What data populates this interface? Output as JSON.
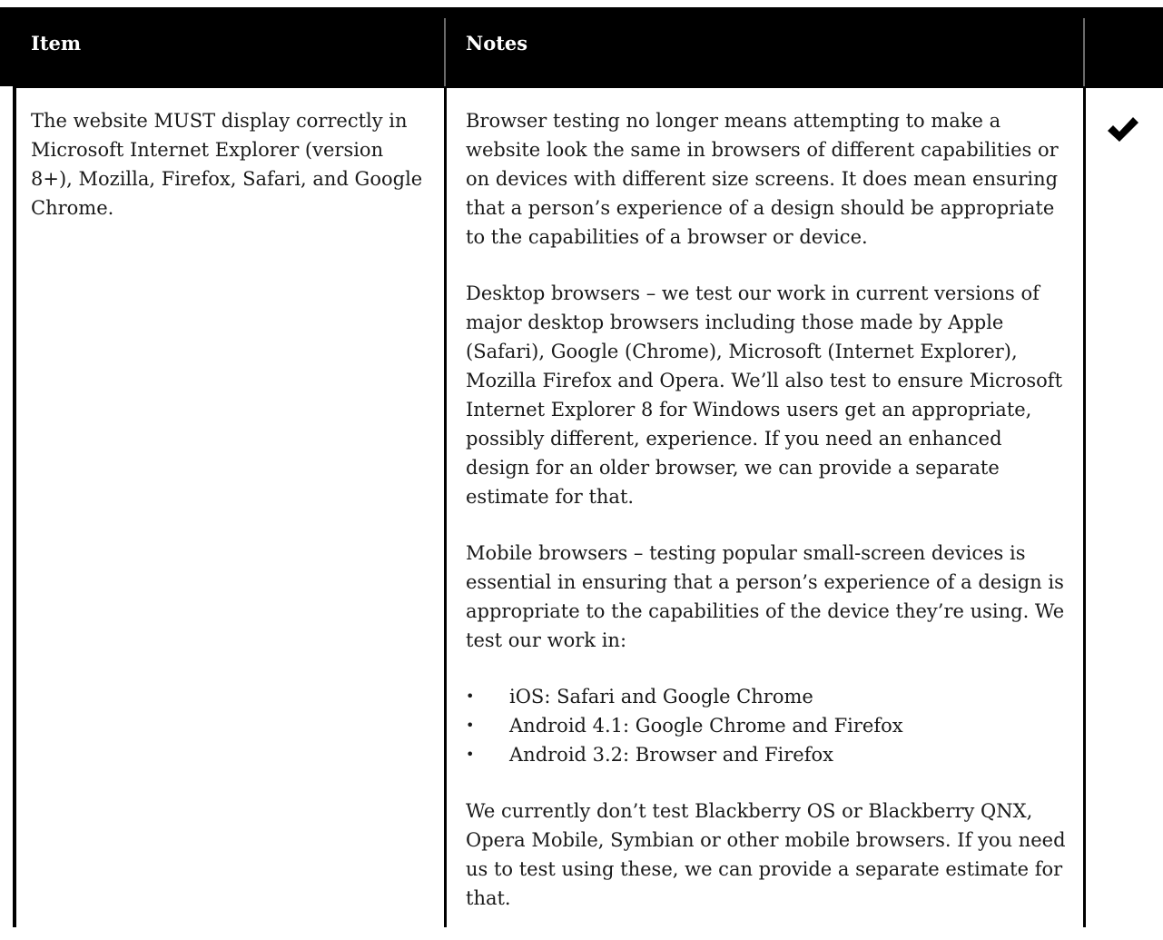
{
  "table": {
    "headers": {
      "item": "Item",
      "notes": "Notes"
    },
    "row": {
      "item": "The website MUST display correctly in Microsoft Internet Explorer (version 8+), Mozilla, Firefox, Safari, and Google Chrome.",
      "notes": {
        "p1": "Browser testing no longer means attempting to make a website look the same in browsers of different capabilities or on devices with different size screens. It does mean ensuring that a person’s experience of a design should be appropriate to the capabilities of a browser or device.",
        "p2": "Desktop browsers – we test our work in current versions of major desktop browsers including those made by Apple (Safari), Google (Chrome), Microsoft (Internet Explorer), Mozilla Firefox and Opera. We’ll also test to ensure Microsoft Internet Explorer 8 for Windows users get an appropriate, possibly different, experience. If you need an enhanced design for an older browser, we can provide a separate estimate for that.",
        "p3": "Mobile browsers – testing popular small-screen devices is essential in ensuring that a person’s experience of a design is appropriate to the capabilities of the device they’re using. We test our work in:",
        "list": [
          "iOS: Safari and Google Chrome",
          "Android 4.1: Google Chrome and Firefox",
          "Android 3.2: Browser and Firefox"
        ],
        "bullet": "•",
        "p4": "We currently don’t test Blackberry OS or Blackberry QNX, Opera Mobile, Symbian or other mobile browsers. If you need us to test using these, we can provide a separate estimate for that."
      },
      "status_icon": "checkmark-icon"
    }
  }
}
